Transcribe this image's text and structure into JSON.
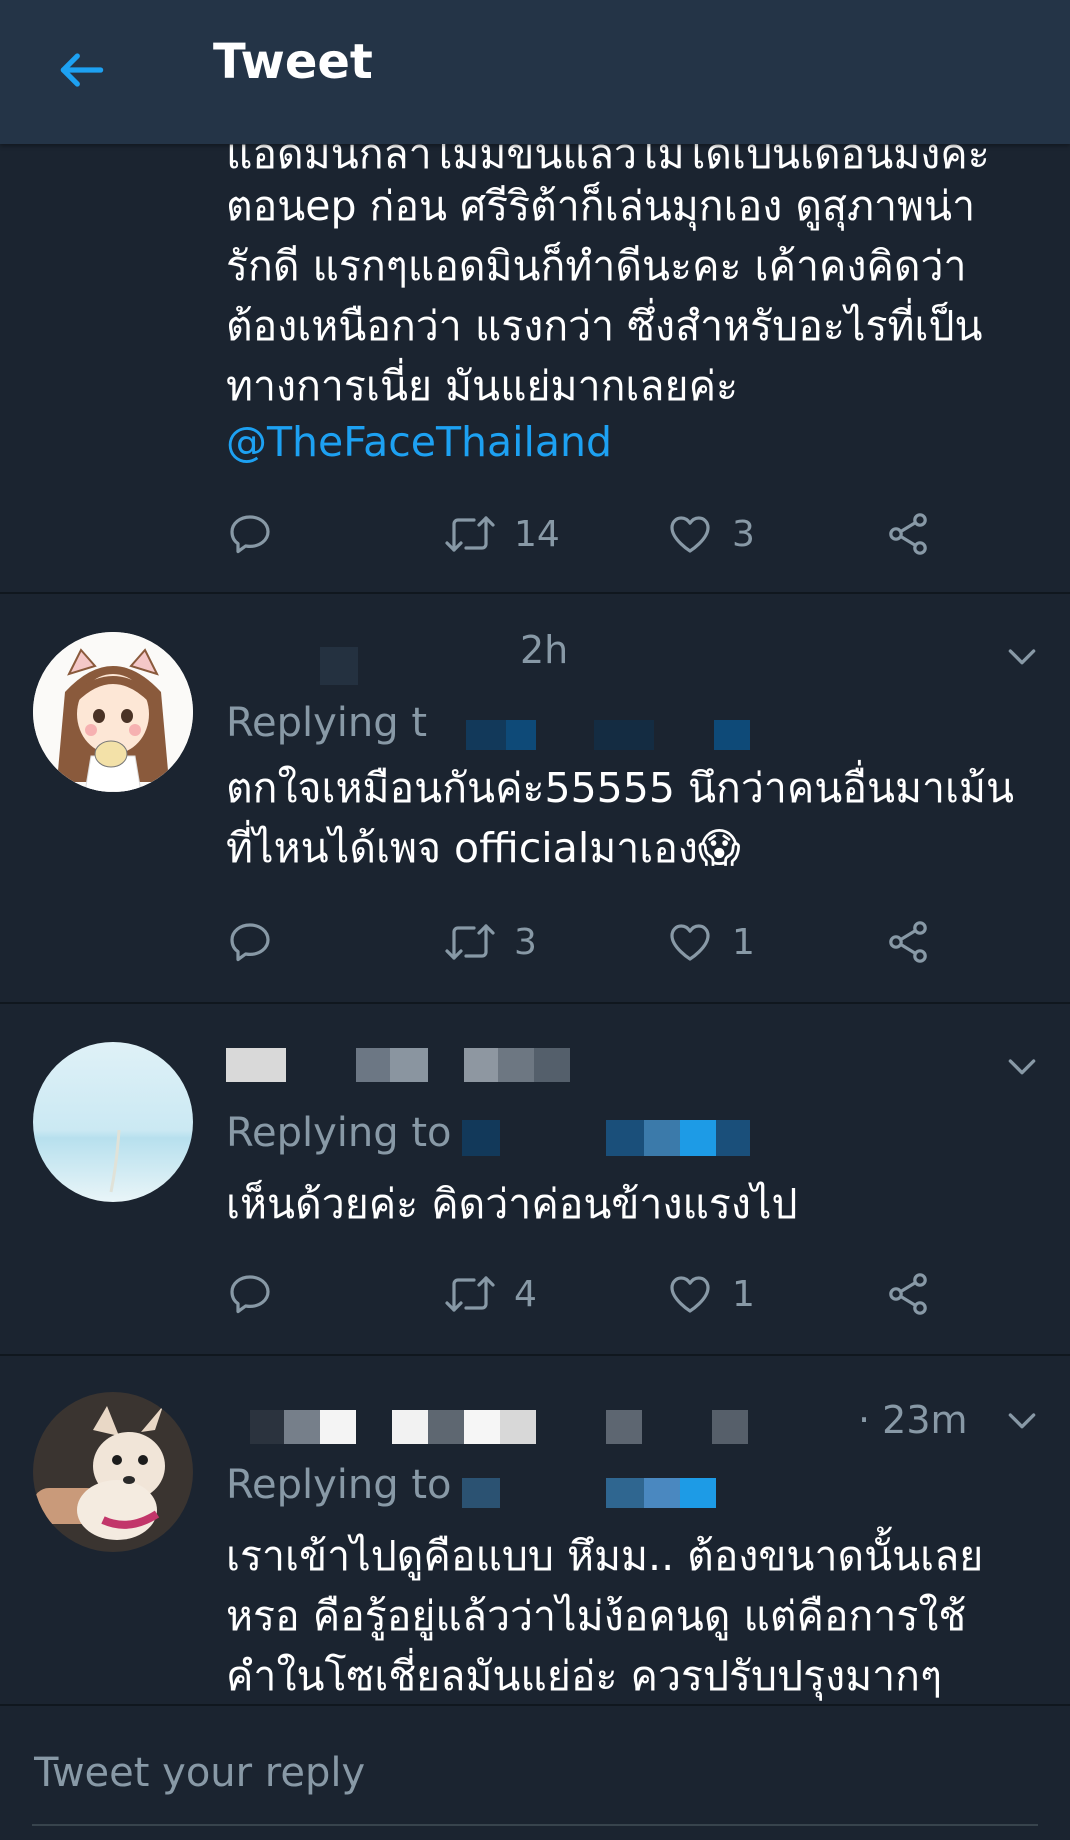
{
  "header": {
    "title": "Tweet"
  },
  "tweets": [
    {
      "partial_line": "แอดมินกล้าไม่มีขึ้นแล้วไม่ได้เป็นเดือนมั่งค่ะ",
      "text": "ตอนep ก่อน ศรีริต้าก็เล่นมุกเอง ดูสุภาพน่า\nรักดี แรกๆแอดมินก็ทำดีนะคะ เค้าคงคิดว่า\nต้องเหนือกว่า แรงกว่า ซึ่งสำหรับอะไรที่เป็น\nทางการเนี่ย มันแย่มากเลยค่ะ",
      "mention": "@TheFaceThailand",
      "retweets": "14",
      "likes": "3"
    },
    {
      "time": "2h",
      "replying": "Replying t",
      "text": "ตกใจเหมือนกันค่ะ55555 นึกว่าคนอื่นมาเม้น\nที่ไหนได้เพจ officialมาเอง😱",
      "retweets": "3",
      "likes": "1"
    },
    {
      "replying": "Replying to",
      "text": "เห็นด้วยค่ะ คิดว่าค่อนข้างแรงไป",
      "retweets": "4",
      "likes": "1"
    },
    {
      "time": "· 23m",
      "replying": "Replying to",
      "text": "เราเข้าไปดูคือแบบ หึมม.. ต้องขนาดนั้นเลย\nหรอ คือรู้อยู่แล้วว่าไม่ง้อคนดู แต่คือการใช้\nคำในโซเชี่ยลมันแย่อ่ะ ควรปรับปรุงมากๆ"
    }
  ],
  "reply_bar": {
    "placeholder": "Tweet your reply"
  },
  "colors": {
    "accent": "#1da1f2",
    "muted": "#8899a6",
    "background": "#1b2430",
    "header": "#243447"
  }
}
